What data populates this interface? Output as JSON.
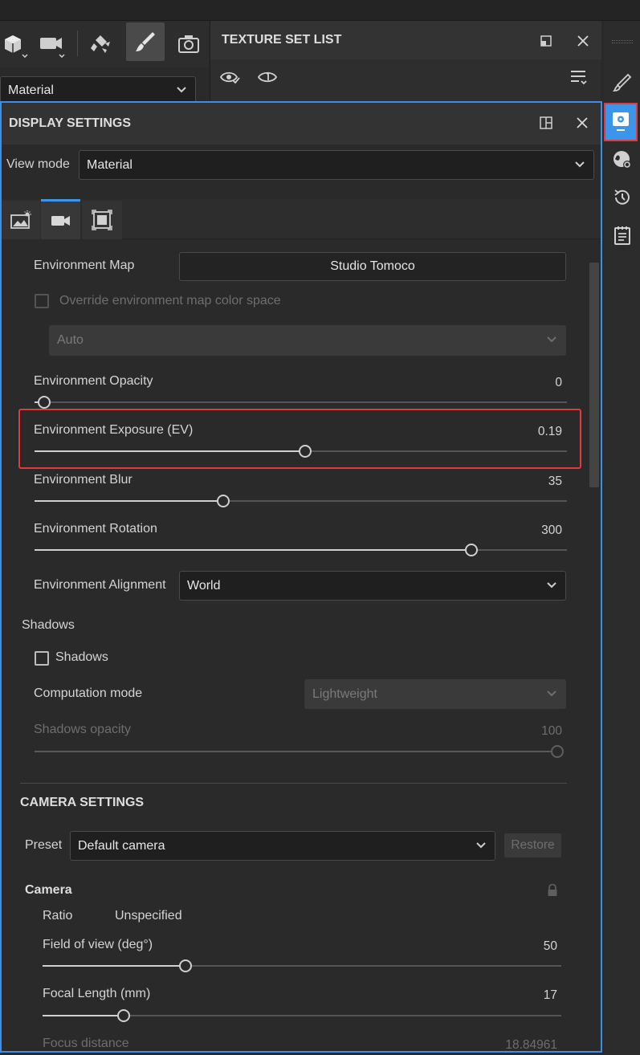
{
  "top_toolbar": {
    "material_dropdown": "Material",
    "icons": [
      "cube-icon",
      "camera-icon",
      "brush-bucket-icon",
      "paintbrush-icon",
      "screenshot-icon"
    ]
  },
  "texture_set_list": {
    "title": "TEXTURE SET LIST"
  },
  "display_settings": {
    "title": "DISPLAY SETTINGS",
    "view_mode_label": "View mode",
    "view_mode_value": "Material",
    "environment_map_label": "Environment Map",
    "environment_map_value": "Studio Tomoco",
    "override_colorspace_label": "Override environment map color space",
    "colorspace_value": "Auto",
    "sliders": [
      {
        "label": "Environment Opacity",
        "value": "0",
        "fraction": 0.018
      },
      {
        "label": "Environment Exposure (EV)",
        "value": "0.19",
        "fraction": 0.508
      },
      {
        "label": "Environment Blur",
        "value": "35",
        "fraction": 0.355
      },
      {
        "label": "Environment Rotation",
        "value": "300",
        "fraction": 0.82
      }
    ],
    "environment_alignment_label": "Environment Alignment",
    "environment_alignment_value": "World",
    "shadows_section": "Shadows",
    "shadows_checkbox_label": "Shadows",
    "computation_mode_label": "Computation mode",
    "computation_mode_value": "Lightweight",
    "shadows_opacity_label": "Shadows opacity",
    "shadows_opacity_value": "100",
    "shadows_opacity_fraction": 1.0
  },
  "camera_settings": {
    "title": "CAMERA SETTINGS",
    "preset_label": "Preset",
    "preset_value": "Default camera",
    "restore_label": "Restore",
    "camera_section": "Camera",
    "ratio_label": "Ratio",
    "ratio_value": "Unspecified",
    "fov_label": "Field of view (deg°)",
    "fov_value": "50",
    "fov_fraction": 0.276,
    "focal_label": "Focal Length (mm)",
    "focal_value": "17",
    "focal_fraction": 0.157,
    "focus_label": "Focus distance",
    "focus_value": "18.84961"
  },
  "colors": {
    "highlight_red": "#e0393e",
    "focus_blue": "#3d8ee8",
    "active_blue": "#3b95ea"
  }
}
